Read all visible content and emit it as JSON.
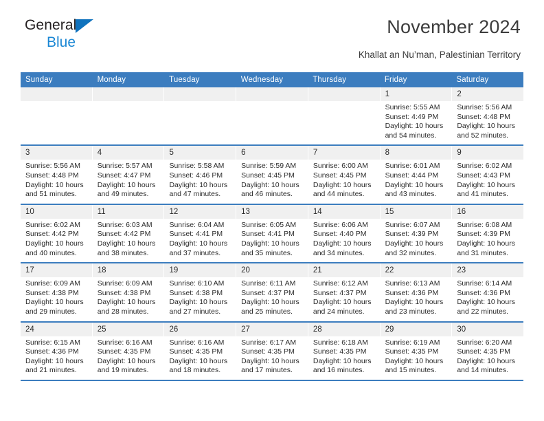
{
  "brand": {
    "name_part1": "General",
    "name_part2": "Blue",
    "triangle_color": "#0f72bd",
    "blue_color": "#1b87d4"
  },
  "header": {
    "title": "November 2024",
    "subtitle": "Khallat an Nu’man, Palestinian Territory"
  },
  "theme": {
    "header_blue": "#3c7dbf",
    "day_number_bg": "#f0f0f0",
    "text_color": "#2b2b2b"
  },
  "weekdays": [
    "Sunday",
    "Monday",
    "Tuesday",
    "Wednesday",
    "Thursday",
    "Friday",
    "Saturday"
  ],
  "weeks": [
    [
      {
        "day": "",
        "sunrise": "",
        "sunset": "",
        "daylight": "",
        "empty": true
      },
      {
        "day": "",
        "sunrise": "",
        "sunset": "",
        "daylight": "",
        "empty": true
      },
      {
        "day": "",
        "sunrise": "",
        "sunset": "",
        "daylight": "",
        "empty": true
      },
      {
        "day": "",
        "sunrise": "",
        "sunset": "",
        "daylight": "",
        "empty": true
      },
      {
        "day": "",
        "sunrise": "",
        "sunset": "",
        "daylight": "",
        "empty": true
      },
      {
        "day": "1",
        "sunrise": "Sunrise: 5:55 AM",
        "sunset": "Sunset: 4:49 PM",
        "daylight": "Daylight: 10 hours and 54 minutes.",
        "empty": false
      },
      {
        "day": "2",
        "sunrise": "Sunrise: 5:56 AM",
        "sunset": "Sunset: 4:48 PM",
        "daylight": "Daylight: 10 hours and 52 minutes.",
        "empty": false
      }
    ],
    [
      {
        "day": "3",
        "sunrise": "Sunrise: 5:56 AM",
        "sunset": "Sunset: 4:48 PM",
        "daylight": "Daylight: 10 hours and 51 minutes.",
        "empty": false
      },
      {
        "day": "4",
        "sunrise": "Sunrise: 5:57 AM",
        "sunset": "Sunset: 4:47 PM",
        "daylight": "Daylight: 10 hours and 49 minutes.",
        "empty": false
      },
      {
        "day": "5",
        "sunrise": "Sunrise: 5:58 AM",
        "sunset": "Sunset: 4:46 PM",
        "daylight": "Daylight: 10 hours and 47 minutes.",
        "empty": false
      },
      {
        "day": "6",
        "sunrise": "Sunrise: 5:59 AM",
        "sunset": "Sunset: 4:45 PM",
        "daylight": "Daylight: 10 hours and 46 minutes.",
        "empty": false
      },
      {
        "day": "7",
        "sunrise": "Sunrise: 6:00 AM",
        "sunset": "Sunset: 4:45 PM",
        "daylight": "Daylight: 10 hours and 44 minutes.",
        "empty": false
      },
      {
        "day": "8",
        "sunrise": "Sunrise: 6:01 AM",
        "sunset": "Sunset: 4:44 PM",
        "daylight": "Daylight: 10 hours and 43 minutes.",
        "empty": false
      },
      {
        "day": "9",
        "sunrise": "Sunrise: 6:02 AM",
        "sunset": "Sunset: 4:43 PM",
        "daylight": "Daylight: 10 hours and 41 minutes.",
        "empty": false
      }
    ],
    [
      {
        "day": "10",
        "sunrise": "Sunrise: 6:02 AM",
        "sunset": "Sunset: 4:42 PM",
        "daylight": "Daylight: 10 hours and 40 minutes.",
        "empty": false
      },
      {
        "day": "11",
        "sunrise": "Sunrise: 6:03 AM",
        "sunset": "Sunset: 4:42 PM",
        "daylight": "Daylight: 10 hours and 38 minutes.",
        "empty": false
      },
      {
        "day": "12",
        "sunrise": "Sunrise: 6:04 AM",
        "sunset": "Sunset: 4:41 PM",
        "daylight": "Daylight: 10 hours and 37 minutes.",
        "empty": false
      },
      {
        "day": "13",
        "sunrise": "Sunrise: 6:05 AM",
        "sunset": "Sunset: 4:41 PM",
        "daylight": "Daylight: 10 hours and 35 minutes.",
        "empty": false
      },
      {
        "day": "14",
        "sunrise": "Sunrise: 6:06 AM",
        "sunset": "Sunset: 4:40 PM",
        "daylight": "Daylight: 10 hours and 34 minutes.",
        "empty": false
      },
      {
        "day": "15",
        "sunrise": "Sunrise: 6:07 AM",
        "sunset": "Sunset: 4:39 PM",
        "daylight": "Daylight: 10 hours and 32 minutes.",
        "empty": false
      },
      {
        "day": "16",
        "sunrise": "Sunrise: 6:08 AM",
        "sunset": "Sunset: 4:39 PM",
        "daylight": "Daylight: 10 hours and 31 minutes.",
        "empty": false
      }
    ],
    [
      {
        "day": "17",
        "sunrise": "Sunrise: 6:09 AM",
        "sunset": "Sunset: 4:38 PM",
        "daylight": "Daylight: 10 hours and 29 minutes.",
        "empty": false
      },
      {
        "day": "18",
        "sunrise": "Sunrise: 6:09 AM",
        "sunset": "Sunset: 4:38 PM",
        "daylight": "Daylight: 10 hours and 28 minutes.",
        "empty": false
      },
      {
        "day": "19",
        "sunrise": "Sunrise: 6:10 AM",
        "sunset": "Sunset: 4:38 PM",
        "daylight": "Daylight: 10 hours and 27 minutes.",
        "empty": false
      },
      {
        "day": "20",
        "sunrise": "Sunrise: 6:11 AM",
        "sunset": "Sunset: 4:37 PM",
        "daylight": "Daylight: 10 hours and 25 minutes.",
        "empty": false
      },
      {
        "day": "21",
        "sunrise": "Sunrise: 6:12 AM",
        "sunset": "Sunset: 4:37 PM",
        "daylight": "Daylight: 10 hours and 24 minutes.",
        "empty": false
      },
      {
        "day": "22",
        "sunrise": "Sunrise: 6:13 AM",
        "sunset": "Sunset: 4:36 PM",
        "daylight": "Daylight: 10 hours and 23 minutes.",
        "empty": false
      },
      {
        "day": "23",
        "sunrise": "Sunrise: 6:14 AM",
        "sunset": "Sunset: 4:36 PM",
        "daylight": "Daylight: 10 hours and 22 minutes.",
        "empty": false
      }
    ],
    [
      {
        "day": "24",
        "sunrise": "Sunrise: 6:15 AM",
        "sunset": "Sunset: 4:36 PM",
        "daylight": "Daylight: 10 hours and 21 minutes.",
        "empty": false
      },
      {
        "day": "25",
        "sunrise": "Sunrise: 6:16 AM",
        "sunset": "Sunset: 4:35 PM",
        "daylight": "Daylight: 10 hours and 19 minutes.",
        "empty": false
      },
      {
        "day": "26",
        "sunrise": "Sunrise: 6:16 AM",
        "sunset": "Sunset: 4:35 PM",
        "daylight": "Daylight: 10 hours and 18 minutes.",
        "empty": false
      },
      {
        "day": "27",
        "sunrise": "Sunrise: 6:17 AM",
        "sunset": "Sunset: 4:35 PM",
        "daylight": "Daylight: 10 hours and 17 minutes.",
        "empty": false
      },
      {
        "day": "28",
        "sunrise": "Sunrise: 6:18 AM",
        "sunset": "Sunset: 4:35 PM",
        "daylight": "Daylight: 10 hours and 16 minutes.",
        "empty": false
      },
      {
        "day": "29",
        "sunrise": "Sunrise: 6:19 AM",
        "sunset": "Sunset: 4:35 PM",
        "daylight": "Daylight: 10 hours and 15 minutes.",
        "empty": false
      },
      {
        "day": "30",
        "sunrise": "Sunrise: 6:20 AM",
        "sunset": "Sunset: 4:35 PM",
        "daylight": "Daylight: 10 hours and 14 minutes.",
        "empty": false
      }
    ]
  ]
}
